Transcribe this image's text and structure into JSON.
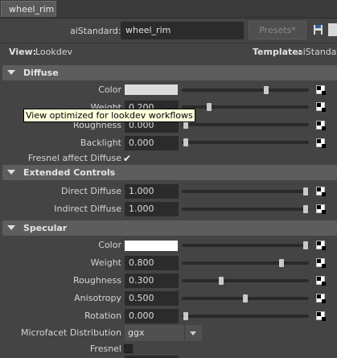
{
  "tab": {
    "label": "wheel_rim"
  },
  "node": {
    "type_label": "aiStandard:",
    "name": "wheel_rim",
    "presets_label": "Presets*"
  },
  "view": {
    "label": "View:",
    "value": "Lookdev",
    "template_label": "Template:",
    "template_value": "aiStandard"
  },
  "tooltip": {
    "text": "View optimized for lookdev workflows"
  },
  "sections": {
    "diffuse": "Diffuse",
    "extended": "Extended Controls",
    "specular": "Specular"
  },
  "diffuse": {
    "color": {
      "label": "Color",
      "swatch": "#dcdcdc",
      "slider": 0.68
    },
    "weight": {
      "label": "Weight",
      "value": "0.200",
      "slider": 0.2
    },
    "roughness": {
      "label": "Roughness",
      "value": "0.000",
      "slider": 0.0
    },
    "backlight": {
      "label": "Backlight",
      "value": "0.000",
      "slider": 0.0
    },
    "fresnel_affect": {
      "label": "Fresnel affect Diffuse",
      "checked": true
    }
  },
  "extended": {
    "direct": {
      "label": "Direct Diffuse",
      "value": "1.000",
      "slider": 1.0
    },
    "indirect": {
      "label": "Indirect Diffuse",
      "value": "1.000",
      "slider": 1.0
    }
  },
  "specular": {
    "color": {
      "label": "Color",
      "swatch": "#ffffff",
      "slider": 1.0
    },
    "weight": {
      "label": "Weight",
      "value": "0.800",
      "slider": 0.8
    },
    "roughness": {
      "label": "Roughness",
      "value": "0.300",
      "slider": 0.3
    },
    "anisotropy": {
      "label": "Anisotropy",
      "value": "0.500",
      "slider": 0.5
    },
    "rotation": {
      "label": "Rotation",
      "value": "0.000",
      "slider": 0.0
    },
    "microfacet": {
      "label": "Microfacet Distribution",
      "value": "ggx"
    },
    "fresnel": {
      "label": "Fresnel",
      "checked": false
    }
  },
  "colors": {
    "panel": "#444444",
    "section": "#5d5d5d",
    "field": "#2b2b2b",
    "tooltip": "#ffffdc"
  },
  "icons": [
    "save-icon",
    "copy-icon",
    "texture-map-icon",
    "collapse-arrow-icon",
    "checkmark-icon",
    "dropdown-arrow-icon"
  ]
}
